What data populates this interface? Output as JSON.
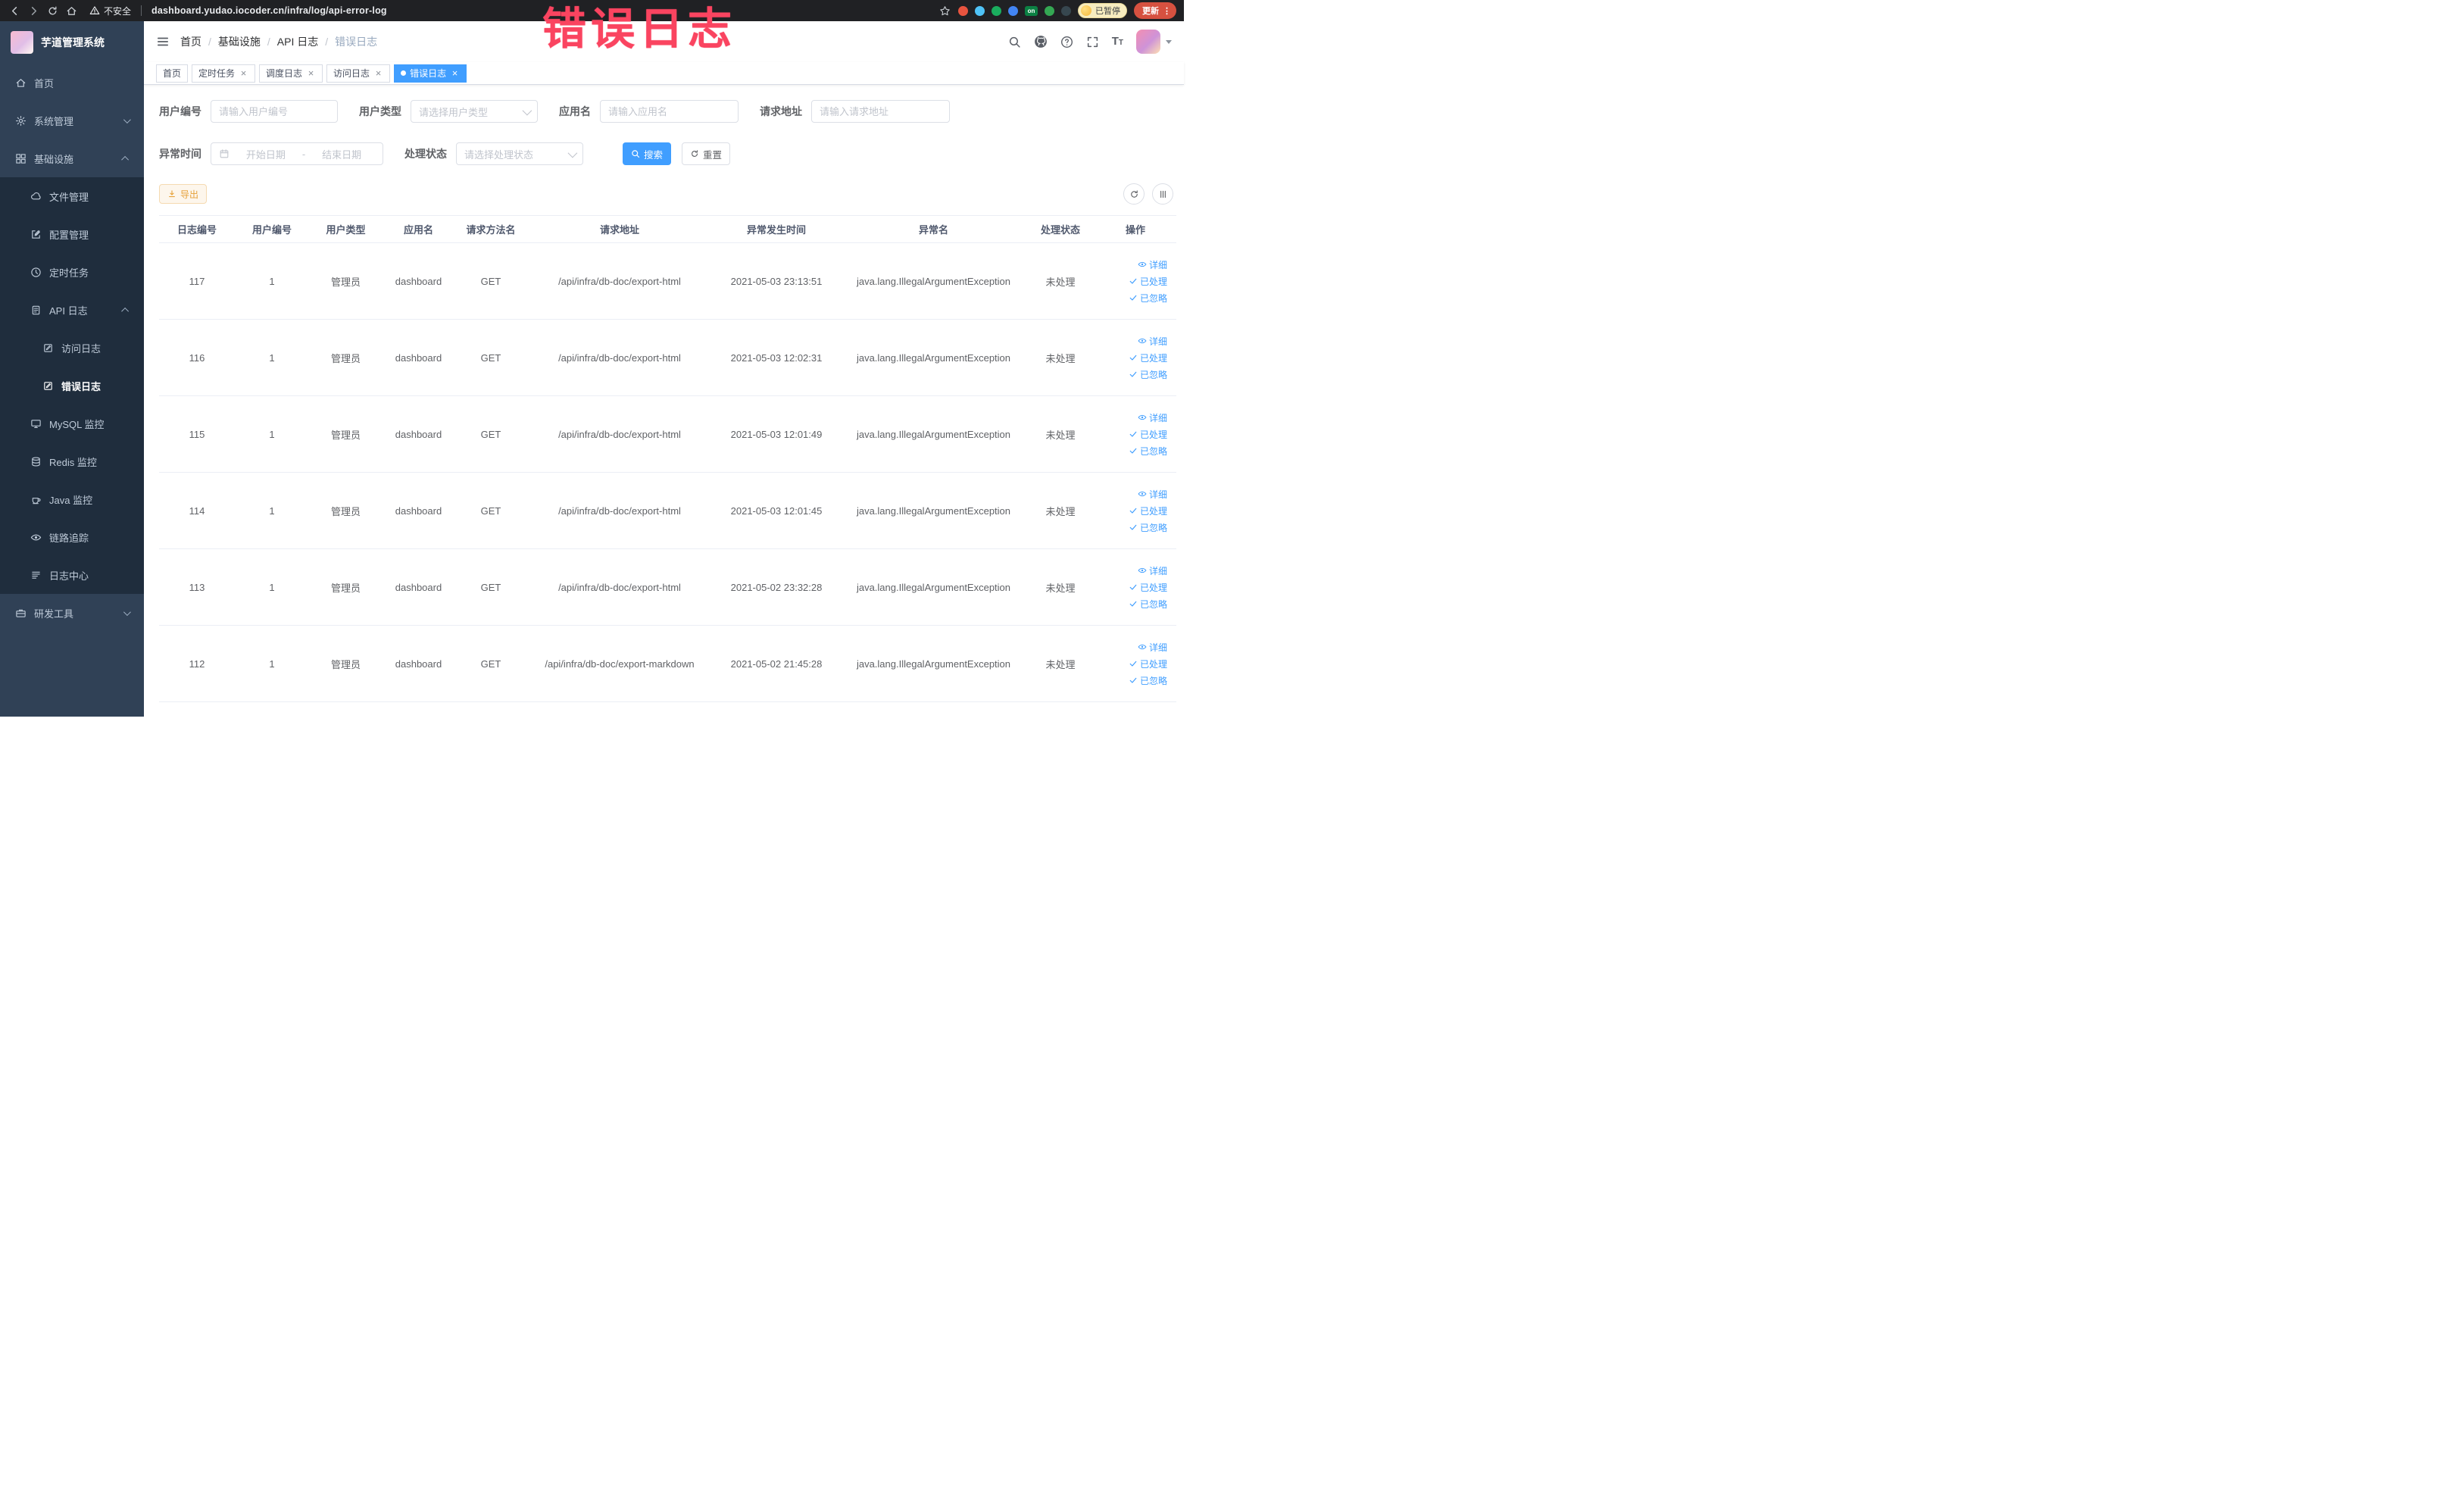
{
  "browser": {
    "security_label": "不安全",
    "url": "dashboard.yudao.iocoder.cn/infra/log/api-error-log",
    "extension_on_badge": "on",
    "paused_badge": "已暂停",
    "update_button": "更新"
  },
  "annotation": {
    "text": "错误日志"
  },
  "sidebar": {
    "logo_title": "芋道管理系统",
    "items": [
      {
        "label": "首页"
      },
      {
        "label": "系统管理"
      },
      {
        "label": "基础设施"
      },
      {
        "label": "文件管理"
      },
      {
        "label": "配置管理"
      },
      {
        "label": "定时任务"
      },
      {
        "label": "API 日志"
      },
      {
        "label": "访问日志"
      },
      {
        "label": "错误日志"
      },
      {
        "label": "MySQL 监控"
      },
      {
        "label": "Redis 监控"
      },
      {
        "label": "Java 监控"
      },
      {
        "label": "链路追踪"
      },
      {
        "label": "日志中心"
      },
      {
        "label": "研发工具"
      }
    ]
  },
  "header": {
    "breadcrumb": [
      "首页",
      "基础设施",
      "API 日志",
      "错误日志"
    ]
  },
  "tabs": [
    {
      "label": "首页"
    },
    {
      "label": "定时任务"
    },
    {
      "label": "调度日志"
    },
    {
      "label": "访问日志"
    },
    {
      "label": "错误日志"
    }
  ],
  "filters": {
    "user_id": {
      "label": "用户编号",
      "placeholder": "请输入用户编号"
    },
    "user_type": {
      "label": "用户类型",
      "placeholder": "请选择用户类型"
    },
    "app_name": {
      "label": "应用名",
      "placeholder": "请输入应用名"
    },
    "request_url": {
      "label": "请求地址",
      "placeholder": "请输入请求地址"
    },
    "exception_time": {
      "label": "异常时间",
      "start_placeholder": "开始日期",
      "separator": "-",
      "end_placeholder": "结束日期"
    },
    "process_status": {
      "label": "处理状态",
      "placeholder": "请选择处理状态"
    },
    "search_label": "搜索",
    "reset_label": "重置"
  },
  "toolbar": {
    "export_label": "导出"
  },
  "table": {
    "columns": [
      "日志编号",
      "用户编号",
      "用户类型",
      "应用名",
      "请求方法名",
      "请求地址",
      "异常发生时间",
      "异常名",
      "处理状态",
      "操作"
    ],
    "actions": {
      "detail": "详细",
      "processed": "已处理",
      "ignored": "已忽略"
    },
    "rows": [
      {
        "id": "117",
        "user_id": "1",
        "user_type": "管理员",
        "app": "dashboard",
        "method": "GET",
        "url": "/api/infra/db-doc/export-html",
        "time": "2021-05-03 23:13:51",
        "exception": "java.lang.IllegalArgumentException",
        "status": "未处理"
      },
      {
        "id": "116",
        "user_id": "1",
        "user_type": "管理员",
        "app": "dashboard",
        "method": "GET",
        "url": "/api/infra/db-doc/export-html",
        "time": "2021-05-03 12:02:31",
        "exception": "java.lang.IllegalArgumentException",
        "status": "未处理"
      },
      {
        "id": "115",
        "user_id": "1",
        "user_type": "管理员",
        "app": "dashboard",
        "method": "GET",
        "url": "/api/infra/db-doc/export-html",
        "time": "2021-05-03 12:01:49",
        "exception": "java.lang.IllegalArgumentException",
        "status": "未处理"
      },
      {
        "id": "114",
        "user_id": "1",
        "user_type": "管理员",
        "app": "dashboard",
        "method": "GET",
        "url": "/api/infra/db-doc/export-html",
        "time": "2021-05-03 12:01:45",
        "exception": "java.lang.IllegalArgumentException",
        "status": "未处理"
      },
      {
        "id": "113",
        "user_id": "1",
        "user_type": "管理员",
        "app": "dashboard",
        "method": "GET",
        "url": "/api/infra/db-doc/export-html",
        "time": "2021-05-02 23:32:28",
        "exception": "java.lang.IllegalArgumentException",
        "status": "未处理"
      },
      {
        "id": "112",
        "user_id": "1",
        "user_type": "管理员",
        "app": "dashboard",
        "method": "GET",
        "url": "/api/infra/db-doc/export-markdown",
        "time": "2021-05-02 21:45:28",
        "exception": "java.lang.IllegalArgumentException",
        "status": "未处理"
      }
    ]
  },
  "glyphs": {
    "close": "×",
    "kebab": "⋮",
    "breadcrumb_separator": "/"
  },
  "colors": {
    "accent": "#409eff",
    "warning": "#e6a23c",
    "annotation": "#fa4460",
    "sidebar_bg": "#304156",
    "submenu_bg": "#1f2d3d",
    "active_tag": "#409eff",
    "update_pill": "#d65140"
  }
}
